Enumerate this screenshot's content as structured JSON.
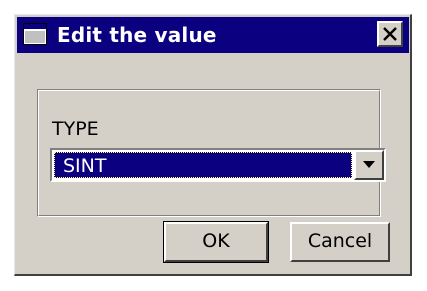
{
  "window": {
    "title": "Edit the value",
    "close_icon": "close-icon"
  },
  "group": {
    "label": "TYPE"
  },
  "type_select": {
    "selected": "SINT"
  },
  "buttons": {
    "ok": "OK",
    "cancel": "Cancel"
  },
  "colors": {
    "titlebar": "#0a0080",
    "dialog_face": "#d4d0c8",
    "selection": "#0a0080"
  }
}
